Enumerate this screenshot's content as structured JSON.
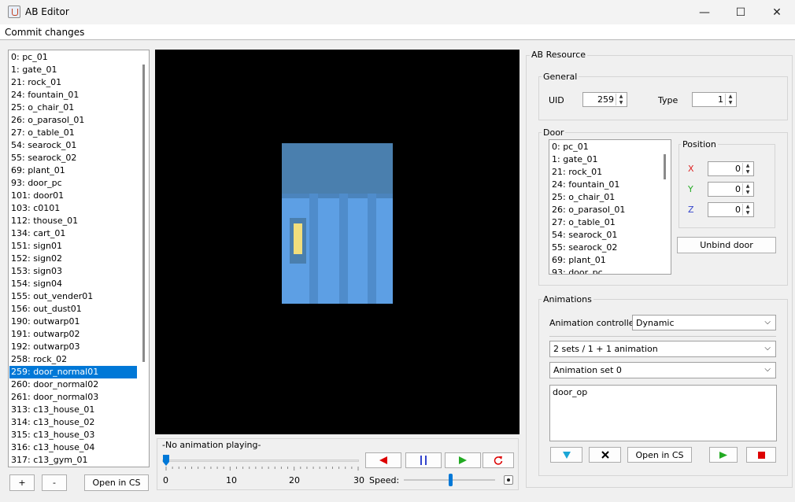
{
  "window": {
    "title": "AB Editor",
    "minimize": "—",
    "maximize": "☐",
    "close": "✕"
  },
  "menu": {
    "commit": "Commit changes"
  },
  "left_list": {
    "items": [
      "0: pc_01",
      "1: gate_01",
      "21: rock_01",
      "24: fountain_01",
      "25: o_chair_01",
      "26: o_parasol_01",
      "27: o_table_01",
      "54: searock_01",
      "55: searock_02",
      "69: plant_01",
      "93: door_pc",
      "101: door01",
      "103: c0101",
      "112: thouse_01",
      "134: cart_01",
      "151: sign01",
      "152: sign02",
      "153: sign03",
      "154: sign04",
      "155: out_vender01",
      "156: out_dust01",
      "190: outwarp01",
      "191: outwarp02",
      "192: outwarp03",
      "258: rock_02",
      "259: door_normal01",
      "260: door_normal02",
      "261: door_normal03",
      "313: c13_house_01",
      "314: c13_house_02",
      "315: c13_house_03",
      "316: c13_house_04",
      "317: c13_gym_01"
    ],
    "selected_index": 25,
    "add_label": "+",
    "remove_label": "-",
    "open_cs_label": "Open in CS"
  },
  "playback": {
    "status": "-No animation playing-",
    "ticks": [
      "0",
      "10",
      "20",
      "30"
    ],
    "speed_label": "Speed:",
    "timeline_value": 0,
    "speed_fraction": 0.5,
    "colors": {
      "play": "#22aa22",
      "stop": "#dd0000",
      "back": "#dd0000",
      "pause": "#3344cc"
    }
  },
  "resource": {
    "title": "AB Resource",
    "general": {
      "title": "General",
      "uid_label": "UID",
      "uid_value": "259",
      "type_label": "Type",
      "type_value": "1"
    },
    "door": {
      "title": "Door",
      "items": [
        "0: pc_01",
        "1: gate_01",
        "21: rock_01",
        "24: fountain_01",
        "25: o_chair_01",
        "26: o_parasol_01",
        "27: o_table_01",
        "54: searock_01",
        "55: searock_02",
        "69: plant_01",
        "93: door_pc"
      ],
      "position": {
        "title": "Position",
        "x_label": "X",
        "y_label": "Y",
        "z_label": "Z",
        "x": "0",
        "y": "0",
        "z": "0"
      },
      "unbind_label": "Unbind door"
    },
    "animations": {
      "title": "Animations",
      "controller_label": "Animation controller",
      "controller_value": "Dynamic",
      "sets_value": "2 sets / 1 + 1 animation",
      "set_value": "Animation set 0",
      "anim_text": "door_op",
      "open_cs_label": "Open in CS",
      "colors": {
        "down": "#1aa6d6",
        "play": "#22aa22",
        "stop": "#dd0000"
      }
    }
  }
}
